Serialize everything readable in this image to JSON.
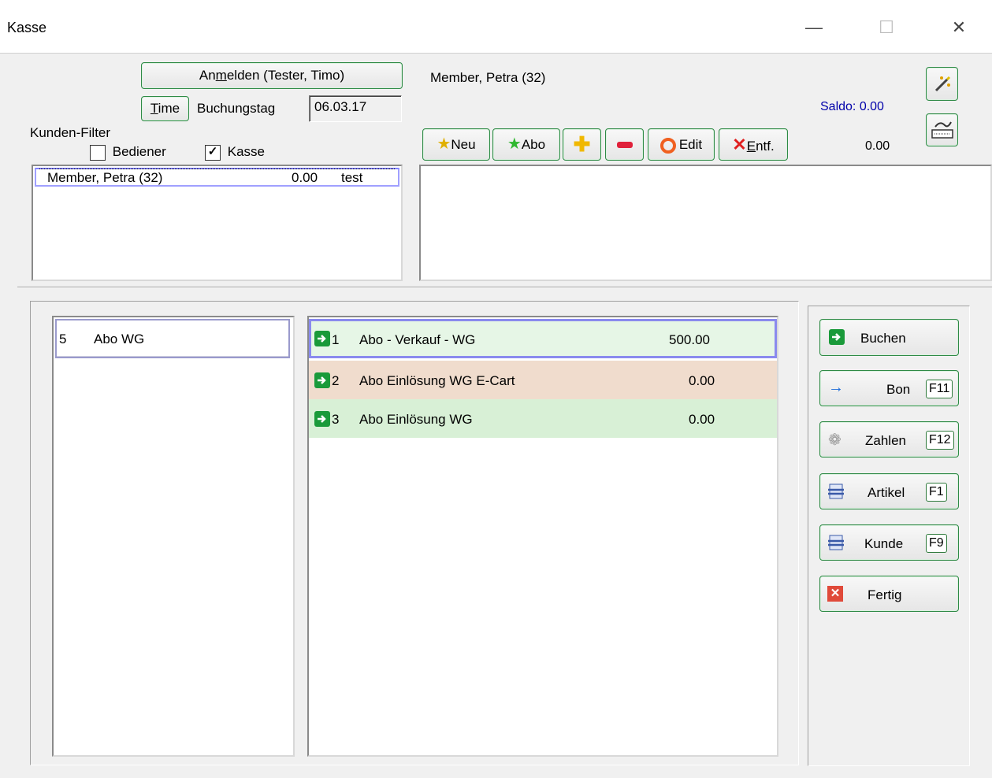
{
  "window": {
    "title": "Kasse",
    "minimize_label": "—",
    "maximize_label": "☐",
    "close_label": "✕"
  },
  "header": {
    "login_pre": "An",
    "login_u": "m",
    "login_post": "elden (Tester, Timo)",
    "time_t": "T",
    "time_rest": "ime",
    "booking_day_label": "Buchungstag",
    "booking_day_value": "06.03.17",
    "customer_filter_label": "Kunden-Filter",
    "filter_bediener": "Bediener",
    "filter_kasse": "Kasse",
    "bediener_checked": false,
    "kasse_checked": true,
    "current_member": "Member, Petra (32)",
    "saldo_label": "Saldo: 0.00",
    "amount": "0.00",
    "saldo_color": "#0000aa"
  },
  "customers": [
    {
      "name": "Member, Petra (32)",
      "balance": "0.00",
      "note": "test"
    }
  ],
  "toolbar": {
    "neu": "Neu",
    "abo": "Abo",
    "edit": "Edit",
    "entf_e": "E",
    "entf_rest": "ntf."
  },
  "groups": [
    {
      "num": "5",
      "label": "Abo WG"
    }
  ],
  "articles": [
    {
      "num": "1",
      "label": "Abo - Verkauf - WG",
      "price": "500.00",
      "bg": "#e6f6e6"
    },
    {
      "num": "2",
      "label": "Abo Einlösung WG E-Cart",
      "price": "0.00",
      "bg": "#f0dccd"
    },
    {
      "num": "3",
      "label": "Abo Einlösung WG",
      "price": "0.00",
      "bg": "#d8f0d6"
    }
  ],
  "actions": {
    "buchen": "Buchen",
    "bon": "Bon",
    "bon_key": "F11",
    "zahlen": "Zahlen",
    "zahlen_key": "F12",
    "artikel": "Artikel",
    "artikel_key": "F1",
    "kunde": "Kunde",
    "kunde_key": "F9",
    "fertig": "Fertig"
  }
}
